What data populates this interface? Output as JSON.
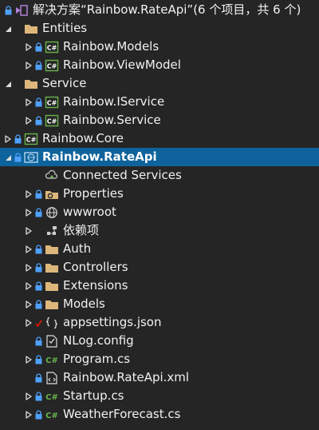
{
  "solution_explorer": {
    "items": [
      {
        "name": "solution-root",
        "label": "解决方案“Rainbow.RateApi”(6 个项目，共 6 个)",
        "depth": 0,
        "arrow": "none",
        "lock": true,
        "icon": "solution-icon"
      },
      {
        "name": "folder-entities",
        "label": "Entities",
        "depth": 0,
        "arrow": "expanded",
        "lock": false,
        "icon": "folder-icon"
      },
      {
        "name": "project-rainbow-models",
        "label": "Rainbow.Models",
        "depth": 1,
        "arrow": "collapsed",
        "lock": true,
        "icon": "csharp-project-icon"
      },
      {
        "name": "project-rainbow-viewmodel",
        "label": "Rainbow.ViewModel",
        "depth": 1,
        "arrow": "collapsed",
        "lock": true,
        "icon": "csharp-project-icon"
      },
      {
        "name": "folder-service",
        "label": "Service",
        "depth": 0,
        "arrow": "expanded",
        "lock": false,
        "icon": "folder-icon"
      },
      {
        "name": "project-rainbow-iservice",
        "label": "Rainbow.IService",
        "depth": 1,
        "arrow": "collapsed",
        "lock": true,
        "icon": "csharp-project-icon"
      },
      {
        "name": "project-rainbow-service",
        "label": "Rainbow.Service",
        "depth": 1,
        "arrow": "collapsed",
        "lock": true,
        "icon": "csharp-project-icon"
      },
      {
        "name": "project-rainbow-core",
        "label": "Rainbow.Core",
        "depth": 0,
        "arrow": "collapsed",
        "lock": true,
        "icon": "csharp-project-icon"
      },
      {
        "name": "project-rainbow-rateapi",
        "label": "Rainbow.RateApi",
        "depth": 0,
        "arrow": "expanded",
        "lock": true,
        "icon": "web-project-icon",
        "selected": true
      },
      {
        "name": "connected-services",
        "label": "Connected Services",
        "depth": 1,
        "arrow": "none",
        "lock": false,
        "icon": "connected-services-icon"
      },
      {
        "name": "properties",
        "label": "Properties",
        "depth": 1,
        "arrow": "collapsed",
        "lock": true,
        "icon": "properties-icon"
      },
      {
        "name": "wwwroot",
        "label": "wwwroot",
        "depth": 1,
        "arrow": "collapsed",
        "lock": true,
        "icon": "globe-icon"
      },
      {
        "name": "dependencies",
        "label": "依赖项",
        "depth": 1,
        "arrow": "collapsed",
        "lock": false,
        "icon": "dependencies-icon"
      },
      {
        "name": "folder-auth",
        "label": "Auth",
        "depth": 1,
        "arrow": "collapsed",
        "lock": true,
        "icon": "folder-icon"
      },
      {
        "name": "folder-controllers",
        "label": "Controllers",
        "depth": 1,
        "arrow": "collapsed",
        "lock": true,
        "icon": "folder-icon"
      },
      {
        "name": "folder-extensions",
        "label": "Extensions",
        "depth": 1,
        "arrow": "collapsed",
        "lock": true,
        "icon": "folder-icon"
      },
      {
        "name": "folder-models",
        "label": "Models",
        "depth": 1,
        "arrow": "collapsed",
        "lock": true,
        "icon": "folder-icon"
      },
      {
        "name": "appsettings-json",
        "label": "appsettings.json",
        "depth": 1,
        "arrow": "collapsed",
        "lock": false,
        "check": true,
        "icon": "json-file-icon"
      },
      {
        "name": "nlog-config",
        "label": "NLog.config",
        "depth": 1,
        "arrow": "none",
        "lock": true,
        "icon": "config-file-icon"
      },
      {
        "name": "program-cs",
        "label": "Program.cs",
        "depth": 1,
        "arrow": "collapsed",
        "lock": true,
        "icon": "csharp-file-icon"
      },
      {
        "name": "rainbow-rateapi-xml",
        "label": "Rainbow.RateApi.xml",
        "depth": 1,
        "arrow": "none",
        "lock": true,
        "icon": "xml-file-icon"
      },
      {
        "name": "startup-cs",
        "label": "Startup.cs",
        "depth": 1,
        "arrow": "collapsed",
        "lock": true,
        "icon": "csharp-file-icon"
      },
      {
        "name": "weatherforecast-cs",
        "label": "WeatherForecast.cs",
        "depth": 1,
        "arrow": "collapsed",
        "lock": true,
        "icon": "csharp-file-icon"
      }
    ]
  },
  "colors": {
    "background": "#252526",
    "selection": "#0e639c",
    "folder": "#dcb67a",
    "csharp": "#68b34a",
    "lock": "#4ea1ff",
    "check": "#e51400"
  }
}
